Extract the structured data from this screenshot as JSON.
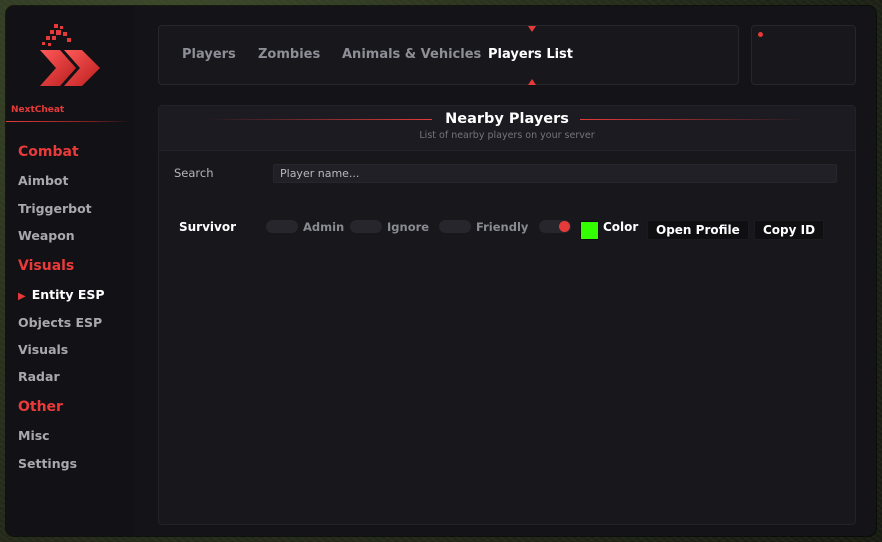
{
  "brand": {
    "name": "NextCheat"
  },
  "colors": {
    "accent": "#e53a3a",
    "player_color": "#33ff00"
  },
  "sidebar": {
    "sections": [
      {
        "title": "Combat",
        "items": [
          "Aimbot",
          "Triggerbot",
          "Weapon"
        ]
      },
      {
        "title": "Visuals",
        "items": [
          "Entity ESP",
          "Objects ESP",
          "Visuals",
          "Radar"
        ]
      },
      {
        "title": "Other",
        "items": [
          "Misc",
          "Settings"
        ]
      }
    ],
    "active_item": "Entity ESP"
  },
  "tabs": {
    "items": [
      "Players",
      "Zombies",
      "Animals & Vehicles",
      "Players List"
    ],
    "active": "Players List"
  },
  "panel": {
    "title": "Nearby Players",
    "subtitle": "List of nearby players on your server"
  },
  "search": {
    "label": "Search",
    "placeholder": "Player name..."
  },
  "players": [
    {
      "name": "Survivor",
      "admin_label": "Admin",
      "ignore_label": "Ignore",
      "friendly_label": "Friendly",
      "admin": false,
      "ignore": false,
      "friendly": false,
      "color_toggle": true,
      "color_label": "Color",
      "open_profile_label": "Open Profile",
      "copy_id_label": "Copy ID"
    }
  ]
}
